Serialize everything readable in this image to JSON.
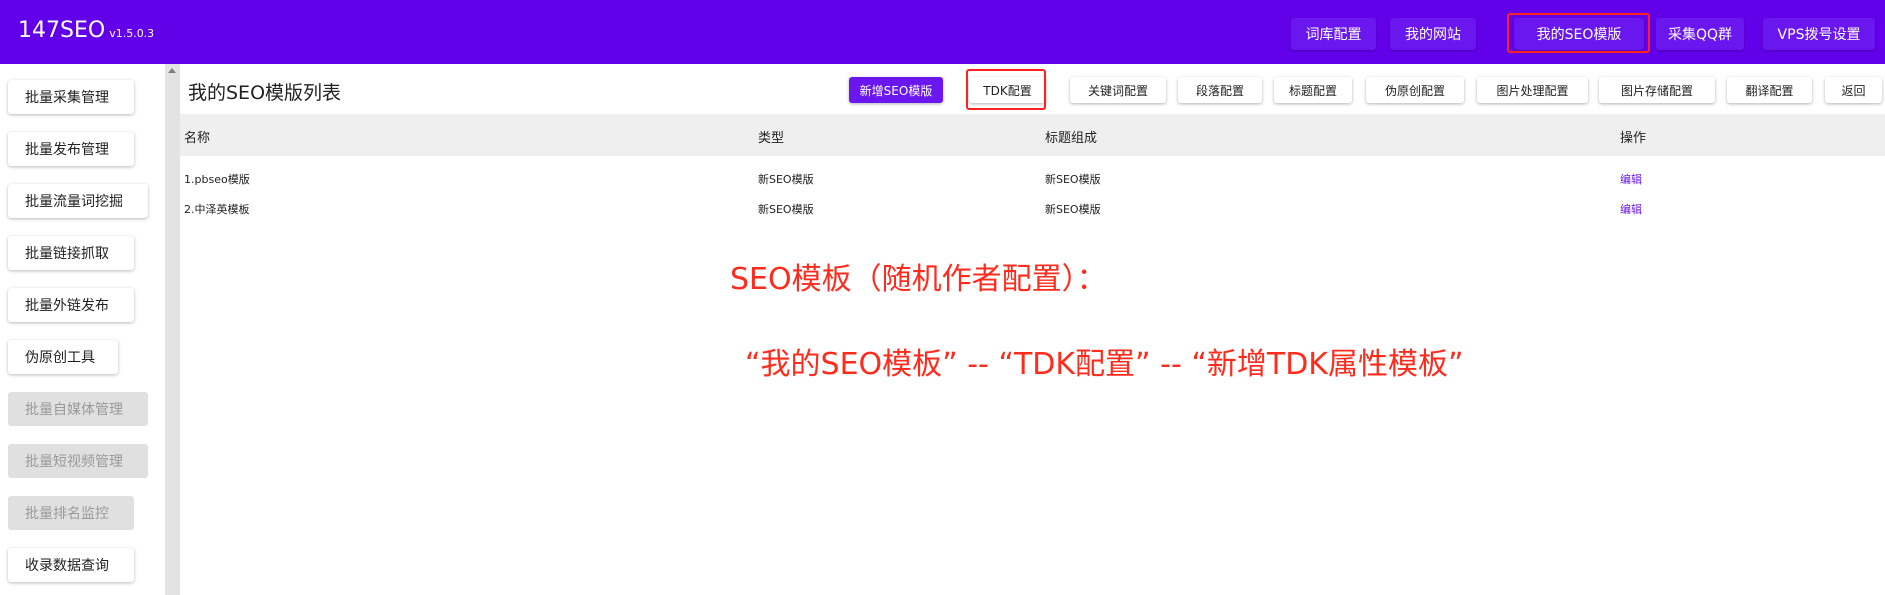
{
  "app": {
    "name": "147SEO",
    "version": "v1.5.0.3"
  },
  "header_nav": [
    {
      "label": "词库配置"
    },
    {
      "label": "我的网站"
    },
    {
      "label": "我的SEO模版"
    },
    {
      "label": "采集QQ群"
    },
    {
      "label": "VPS拨号设置"
    }
  ],
  "sidebar": {
    "items": [
      {
        "label": "批量采集管理",
        "disabled": false
      },
      {
        "label": "批量发布管理",
        "disabled": false
      },
      {
        "label": "批量流量词挖掘",
        "disabled": false
      },
      {
        "label": "批量链接抓取",
        "disabled": false
      },
      {
        "label": "批量外链发布",
        "disabled": false
      },
      {
        "label": "伪原创工具",
        "disabled": false
      },
      {
        "label": "批量自媒体管理",
        "disabled": true
      },
      {
        "label": "批量短视频管理",
        "disabled": true
      },
      {
        "label": "批量排名监控",
        "disabled": true
      },
      {
        "label": "收录数据查询",
        "disabled": false
      }
    ]
  },
  "main": {
    "title": "我的SEO模版列表",
    "toolbar": {
      "add_label": "新增SEO模版",
      "tdk_label": "TDK配置",
      "keyword_label": "关键词配置",
      "paragraph_label": "段落配置",
      "heading_label": "标题配置",
      "pseudo_label": "伪原创配置",
      "image_process_label": "图片处理配置",
      "image_storage_label": "图片存储配置",
      "translate_label": "翻译配置",
      "back_label": "返回"
    },
    "table": {
      "columns": [
        "名称",
        "类型",
        "标题组成",
        "操作"
      ],
      "rows": [
        {
          "name": "1.pbseo模版",
          "type": "新SEO模版",
          "title_composition": "新SEO模版",
          "action": "编辑"
        },
        {
          "name": "2.中泽英模板",
          "type": "新SEO模版",
          "title_composition": "新SEO模版",
          "action": "编辑"
        }
      ]
    }
  },
  "annotations": {
    "line1": "SEO模板（随机作者配置）：",
    "line2": "“我的SEO模板”  --  “TDK配置”  --  “新增TDK属性模板”"
  },
  "colors": {
    "brand": "#6200ea",
    "button_primary": "#6a16ee",
    "highlight": "#ff2020",
    "annotation": "#ff2b1c"
  }
}
